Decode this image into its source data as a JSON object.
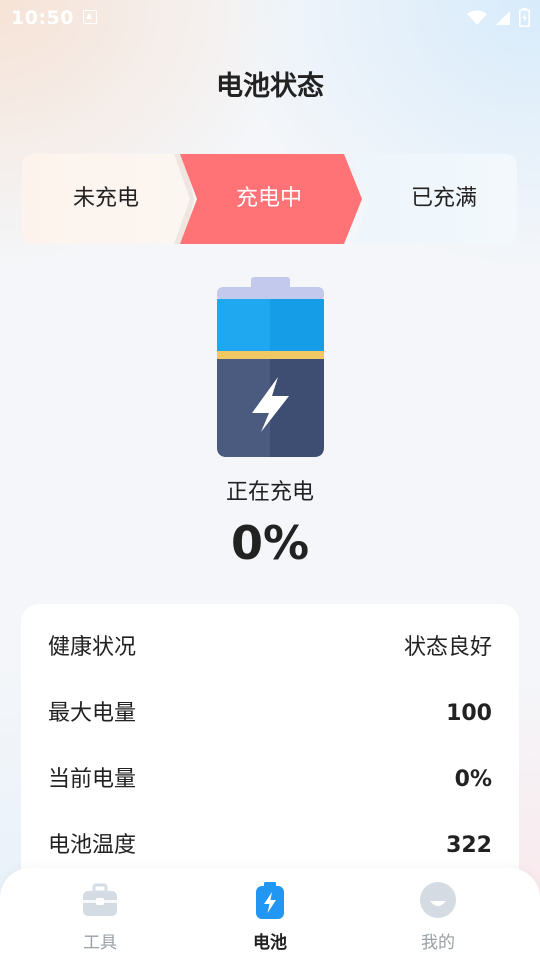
{
  "status_bar": {
    "time": "10:50"
  },
  "header": {
    "title": "电池状态"
  },
  "stepper": {
    "steps": [
      {
        "label": "未充电"
      },
      {
        "label": "充电中"
      },
      {
        "label": "已充满"
      }
    ],
    "active_index": 1
  },
  "battery": {
    "status_text": "正在充电",
    "level_text": "0%",
    "level_fraction": 0
  },
  "info": {
    "rows": [
      {
        "label": "健康状况",
        "value": "状态良好"
      },
      {
        "label": "最大电量",
        "value": "100"
      },
      {
        "label": "当前电量",
        "value": "0%"
      },
      {
        "label": "电池温度",
        "value": "322"
      }
    ]
  },
  "bottom_nav": {
    "items": [
      {
        "label": "工具",
        "icon": "toolbox-icon"
      },
      {
        "label": "电池",
        "icon": "battery-icon"
      },
      {
        "label": "我的",
        "icon": "profile-icon"
      }
    ],
    "active_index": 1
  },
  "colors": {
    "active_step": "#ff7276",
    "battery_top": "#1fa7ef",
    "battery_bottom": "#3e4e72",
    "battery_band": "#f2c864",
    "battery_cap": "#c3c9ec",
    "nav_active_icon": "#2196f3",
    "nav_inactive_icon": "#d4dbe3"
  }
}
